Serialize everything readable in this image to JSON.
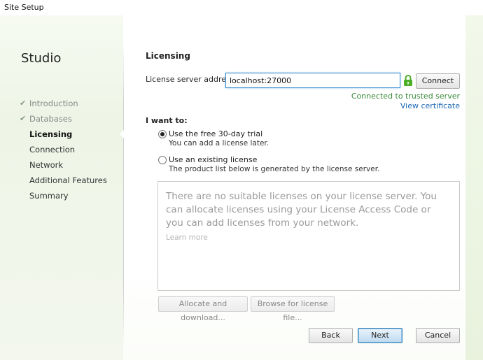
{
  "window": {
    "title": "Site Setup"
  },
  "sidebar": {
    "title": "Studio",
    "items": [
      {
        "label": "Introduction",
        "state": "done"
      },
      {
        "label": "Databases",
        "state": "done"
      },
      {
        "label": "Licensing",
        "state": "active"
      },
      {
        "label": "Connection",
        "state": "pending"
      },
      {
        "label": "Network",
        "state": "pending"
      },
      {
        "label": "Additional Features",
        "state": "pending"
      },
      {
        "label": "Summary",
        "state": "pending"
      }
    ]
  },
  "main": {
    "section_title": "Licensing",
    "server": {
      "label": "License server address:",
      "value": "localhost:27000",
      "connect_label": "Connect",
      "status": "Connected to trusted server",
      "view_certificate": "View certificate"
    },
    "want_to_label": "I want to:",
    "options": [
      {
        "label": "Use the free 30-day trial",
        "sub": "You can add a license later.",
        "selected": true
      },
      {
        "label": "Use an existing license",
        "sub": "The product list below is generated by the license server.",
        "selected": false
      }
    ],
    "license_box": {
      "message": "There are no suitable licenses on your license server. You can allocate licenses using your License Access Code or you can add licenses from your network.",
      "learn_more": "Learn more"
    },
    "allocate_label": "Allocate and download...",
    "browse_label": "Browse for license file..."
  },
  "footer": {
    "back_label": "Back",
    "next_label": "Next",
    "cancel_label": "Cancel"
  },
  "colors": {
    "accent": "#3d8ecf",
    "status_ok": "#3a8a3a",
    "link": "#1d68b4",
    "lock": "#4caf27"
  },
  "icons": [
    "check-icon",
    "lock-icon"
  ]
}
